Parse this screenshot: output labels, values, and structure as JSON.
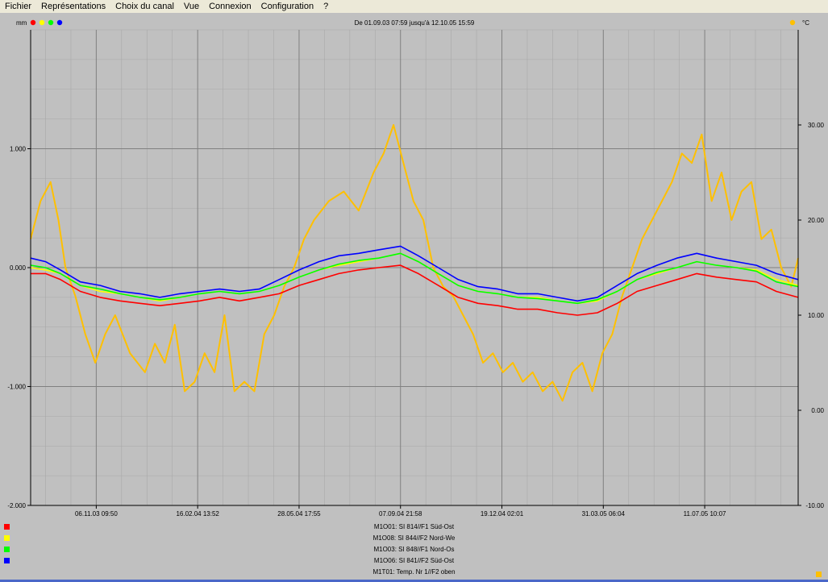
{
  "menu": [
    "Fichier",
    "Représentations",
    "Choix du canal",
    "Vue",
    "Connexion",
    "Configuration",
    "?"
  ],
  "header": {
    "left_unit": "mm",
    "right_unit": "°C",
    "range_text": "De 01.09.03 07:59 jusqu'à 12.10.05 15:59"
  },
  "colors": {
    "red": "#ff0000",
    "yellow": "#ffff00",
    "green": "#00ff00",
    "blue": "#0000ff",
    "temp": "#ffc000",
    "plot_bg": "#c0c0c0",
    "grid": "#808080"
  },
  "legend": [
    {
      "label": "M1O01: SI 814//F1 Süd-Ost",
      "color": "#ff0000"
    },
    {
      "label": "M1O08: SI 844//F2 Nord-We",
      "color": "#ffff00"
    },
    {
      "label": "M1O03: SI 848//F1 Nord-Os",
      "color": "#00ff00"
    },
    {
      "label": "M1O06: SI 841//F2 Süd-Ost",
      "color": "#0000ff"
    },
    {
      "label": "M1T01: Temp. Nr 1//F2 oben",
      "color": "#ffc000"
    }
  ],
  "chart_data": {
    "type": "line",
    "x_ticks": [
      "06.11.03 09:50",
      "16.02.04 13:52",
      "28.05.04 17:55",
      "07.09.04 21:58",
      "19.12.04 02:01",
      "31.03.05 06:04",
      "11.07.05 10:07"
    ],
    "x_tick_days": [
      66,
      168,
      270,
      372,
      474,
      576,
      678
    ],
    "xlim_days": [
      0,
      772
    ],
    "y_left": {
      "unit": "mm",
      "ylim": [
        -2.0,
        2.0
      ],
      "ticks": [
        -2.0,
        -1.0,
        0.0,
        1.0
      ],
      "tick_labels": [
        "-2.000",
        "-1.000",
        "0.000",
        "1.000"
      ]
    },
    "y_right": {
      "unit": "°C",
      "ylim": [
        -10,
        40
      ],
      "ticks": [
        -10,
        0,
        10,
        20,
        30
      ],
      "tick_labels": [
        "-10.00",
        "0.00",
        "10.00",
        "20.00",
        "30.00"
      ]
    },
    "grid": true,
    "series": [
      {
        "name": "M1O01: SI 814//F1 Süd-Ost",
        "axis": "left",
        "color": "#ff0000",
        "x": [
          0,
          15,
          30,
          50,
          70,
          90,
          110,
          130,
          150,
          170,
          190,
          210,
          230,
          250,
          270,
          290,
          310,
          330,
          350,
          372,
          390,
          410,
          430,
          450,
          470,
          490,
          510,
          530,
          550,
          570,
          590,
          610,
          630,
          650,
          670,
          690,
          710,
          730,
          750,
          772
        ],
        "y": [
          -0.05,
          -0.05,
          -0.1,
          -0.2,
          -0.25,
          -0.28,
          -0.3,
          -0.32,
          -0.3,
          -0.28,
          -0.25,
          -0.28,
          -0.25,
          -0.22,
          -0.15,
          -0.1,
          -0.05,
          -0.02,
          0.0,
          0.02,
          -0.05,
          -0.15,
          -0.25,
          -0.3,
          -0.32,
          -0.35,
          -0.35,
          -0.38,
          -0.4,
          -0.38,
          -0.3,
          -0.2,
          -0.15,
          -0.1,
          -0.05,
          -0.08,
          -0.1,
          -0.12,
          -0.2,
          -0.25
        ]
      },
      {
        "name": "M1O08: SI 844//F2 Nord-We",
        "axis": "left",
        "color": "#ffff00",
        "x": [
          0,
          15,
          30,
          50,
          70,
          90,
          110,
          130,
          150,
          170,
          190,
          210,
          230,
          250,
          270,
          290,
          310,
          330,
          350,
          372,
          390,
          410,
          430,
          450,
          470,
          490,
          510,
          530,
          550,
          570,
          590,
          610,
          630,
          650,
          670,
          690,
          710,
          730,
          750,
          772
        ],
        "y": [
          0.0,
          -0.02,
          -0.05,
          -0.15,
          -0.2,
          -0.22,
          -0.25,
          -0.28,
          -0.25,
          -0.22,
          -0.2,
          -0.22,
          -0.2,
          -0.15,
          -0.08,
          -0.02,
          0.02,
          0.05,
          0.08,
          0.12,
          0.05,
          -0.05,
          -0.15,
          -0.2,
          -0.22,
          -0.25,
          -0.25,
          -0.28,
          -0.3,
          -0.28,
          -0.2,
          -0.1,
          -0.05,
          0.0,
          0.05,
          0.02,
          0.0,
          -0.02,
          -0.1,
          -0.15
        ]
      },
      {
        "name": "M1O03: SI 848//F1 Nord-Os",
        "axis": "left",
        "color": "#00ff00",
        "x": [
          0,
          15,
          30,
          50,
          70,
          90,
          110,
          130,
          150,
          170,
          190,
          210,
          230,
          250,
          270,
          290,
          310,
          330,
          350,
          372,
          390,
          410,
          430,
          450,
          470,
          490,
          510,
          530,
          550,
          570,
          590,
          610,
          630,
          650,
          670,
          690,
          710,
          730,
          750,
          772
        ],
        "y": [
          0.02,
          0.0,
          -0.05,
          -0.15,
          -0.18,
          -0.22,
          -0.25,
          -0.27,
          -0.25,
          -0.22,
          -0.2,
          -0.22,
          -0.2,
          -0.15,
          -0.08,
          -0.02,
          0.03,
          0.06,
          0.08,
          0.12,
          0.05,
          -0.05,
          -0.15,
          -0.2,
          -0.22,
          -0.25,
          -0.26,
          -0.28,
          -0.3,
          -0.27,
          -0.2,
          -0.1,
          -0.04,
          0.0,
          0.05,
          0.02,
          0.0,
          -0.03,
          -0.12,
          -0.16
        ]
      },
      {
        "name": "M1O06: SI 841//F2 Süd-Ost",
        "axis": "left",
        "color": "#0000ff",
        "x": [
          0,
          15,
          30,
          50,
          70,
          90,
          110,
          130,
          150,
          170,
          190,
          210,
          230,
          250,
          270,
          290,
          310,
          330,
          350,
          372,
          390,
          410,
          430,
          450,
          470,
          490,
          510,
          530,
          550,
          570,
          590,
          610,
          630,
          650,
          670,
          690,
          710,
          730,
          750,
          772
        ],
        "y": [
          0.08,
          0.05,
          -0.02,
          -0.12,
          -0.15,
          -0.2,
          -0.22,
          -0.25,
          -0.22,
          -0.2,
          -0.18,
          -0.2,
          -0.18,
          -0.1,
          -0.02,
          0.05,
          0.1,
          0.12,
          0.15,
          0.18,
          0.1,
          0.0,
          -0.1,
          -0.16,
          -0.18,
          -0.22,
          -0.22,
          -0.25,
          -0.28,
          -0.25,
          -0.15,
          -0.05,
          0.02,
          0.08,
          0.12,
          0.08,
          0.05,
          0.02,
          -0.05,
          -0.1
        ]
      },
      {
        "name": "M1T01: Temp. Nr 1//F2 oben",
        "axis": "right",
        "color": "#ffc000",
        "x": [
          0,
          10,
          20,
          28,
          35,
          45,
          55,
          65,
          75,
          85,
          100,
          115,
          125,
          135,
          145,
          155,
          165,
          175,
          185,
          195,
          205,
          215,
          225,
          235,
          245,
          255,
          265,
          275,
          285,
          300,
          315,
          330,
          345,
          355,
          365,
          375,
          385,
          395,
          405,
          415,
          425,
          435,
          445,
          455,
          465,
          475,
          485,
          495,
          505,
          515,
          525,
          535,
          545,
          555,
          565,
          575,
          585,
          595,
          605,
          615,
          625,
          635,
          645,
          655,
          665,
          675,
          685,
          695,
          705,
          715,
          725,
          735,
          745,
          755,
          765,
          772
        ],
        "y": [
          18,
          22,
          24,
          20,
          15,
          12,
          8,
          5,
          8,
          10,
          6,
          4,
          7,
          5,
          9,
          2,
          3,
          6,
          4,
          10,
          2,
          3,
          2,
          8,
          10,
          13,
          15,
          18,
          20,
          22,
          23,
          21,
          25,
          27,
          30,
          26,
          22,
          20,
          15,
          13,
          12,
          10,
          8,
          5,
          6,
          4,
          5,
          3,
          4,
          2,
          3,
          1,
          4,
          5,
          2,
          6,
          8,
          12,
          15,
          18,
          20,
          22,
          24,
          27,
          26,
          29,
          22,
          25,
          20,
          23,
          24,
          18,
          19,
          15,
          13,
          16
        ]
      }
    ]
  }
}
